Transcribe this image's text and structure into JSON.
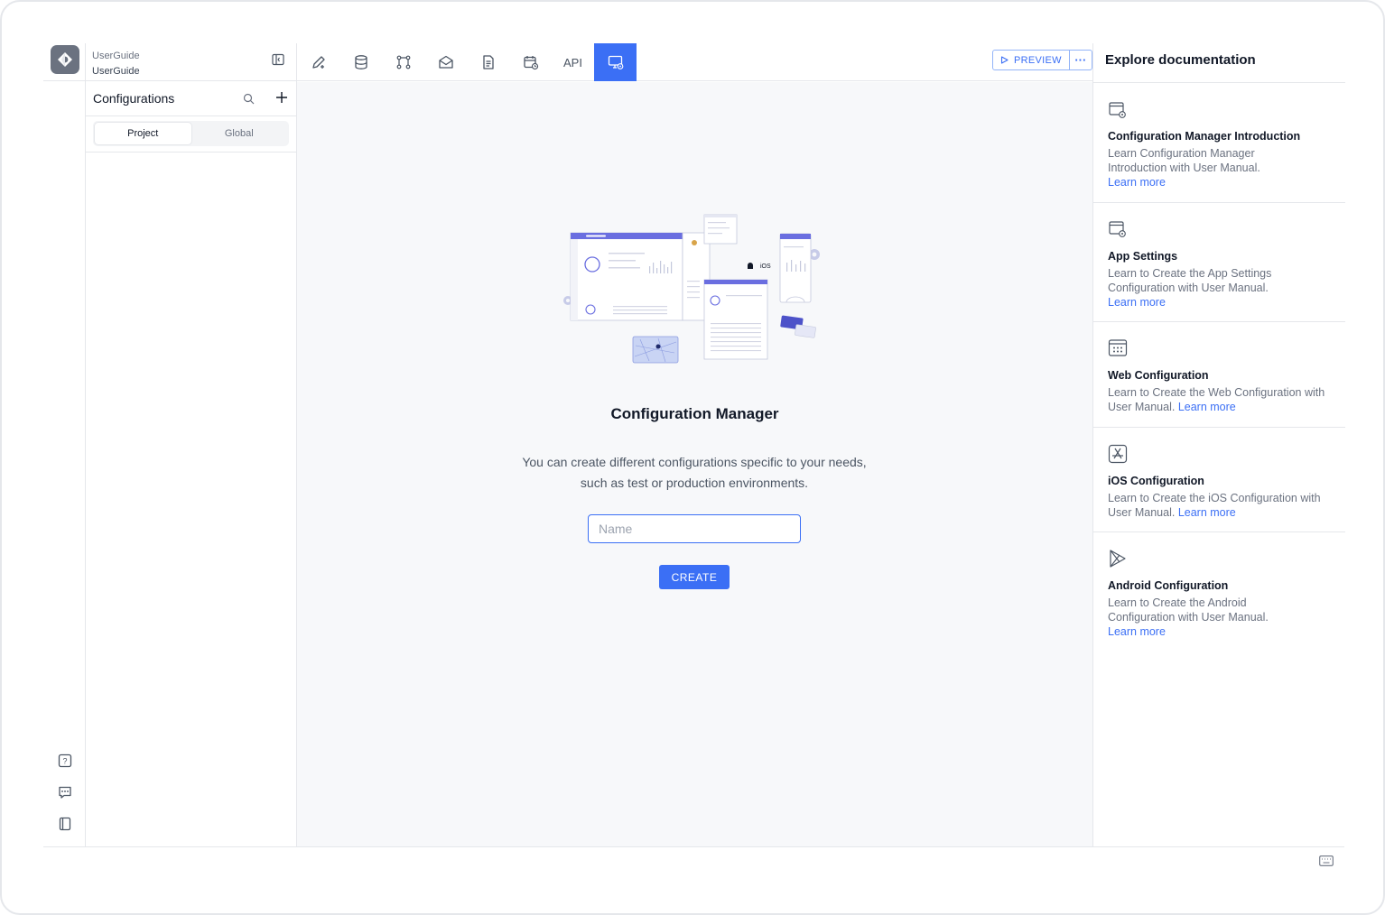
{
  "app": {
    "line1": "UserGuide",
    "line2": "UserGuide"
  },
  "sidebar": {
    "title": "Configurations",
    "tabs": [
      {
        "label": "Project",
        "active": true
      },
      {
        "label": "Global",
        "active": false
      }
    ]
  },
  "toolbar": {
    "tools": [
      "edit-icon",
      "database-icon",
      "workflow-icon",
      "mail-icon",
      "document-icon",
      "calendar-icon",
      "API",
      "configuration-icon"
    ],
    "api_label": "API",
    "preview_label": "PREVIEW",
    "more_label": "···"
  },
  "main": {
    "title": "Configuration Manager",
    "desc_line1": "You can create different configurations specific to your needs,",
    "desc_line2": "such as test or production environments.",
    "name_placeholder": "Name",
    "name_value": "",
    "create_label": "CREATE",
    "illustration_ios_label": "iOS"
  },
  "docs": {
    "title": "Explore documentation",
    "learn_more": "Learn more",
    "items": [
      {
        "title": "Configuration Manager Introduction",
        "desc": "Learn Configuration Manager Introduction with User Manual.",
        "icon": "settings-window-icon"
      },
      {
        "title": "App Settings",
        "desc": "Learn to Create the App Settings Configuration with User Manual.",
        "icon": "settings-window-icon"
      },
      {
        "title": "Web Configuration",
        "desc": "Learn to Create the Web Configuration with User Manual.",
        "icon": "web-grid-icon"
      },
      {
        "title": "iOS Configuration",
        "desc": "Learn to Create the iOS Configuration with User Manual.",
        "icon": "app-store-icon"
      },
      {
        "title": "Android Configuration",
        "desc": "Learn to Create the Android Configuration with User Manual.",
        "icon": "play-store-icon"
      }
    ]
  },
  "colors": {
    "accent": "#3b6ff5",
    "border": "#e5e7eb",
    "main_bg": "#f7f8fa"
  }
}
